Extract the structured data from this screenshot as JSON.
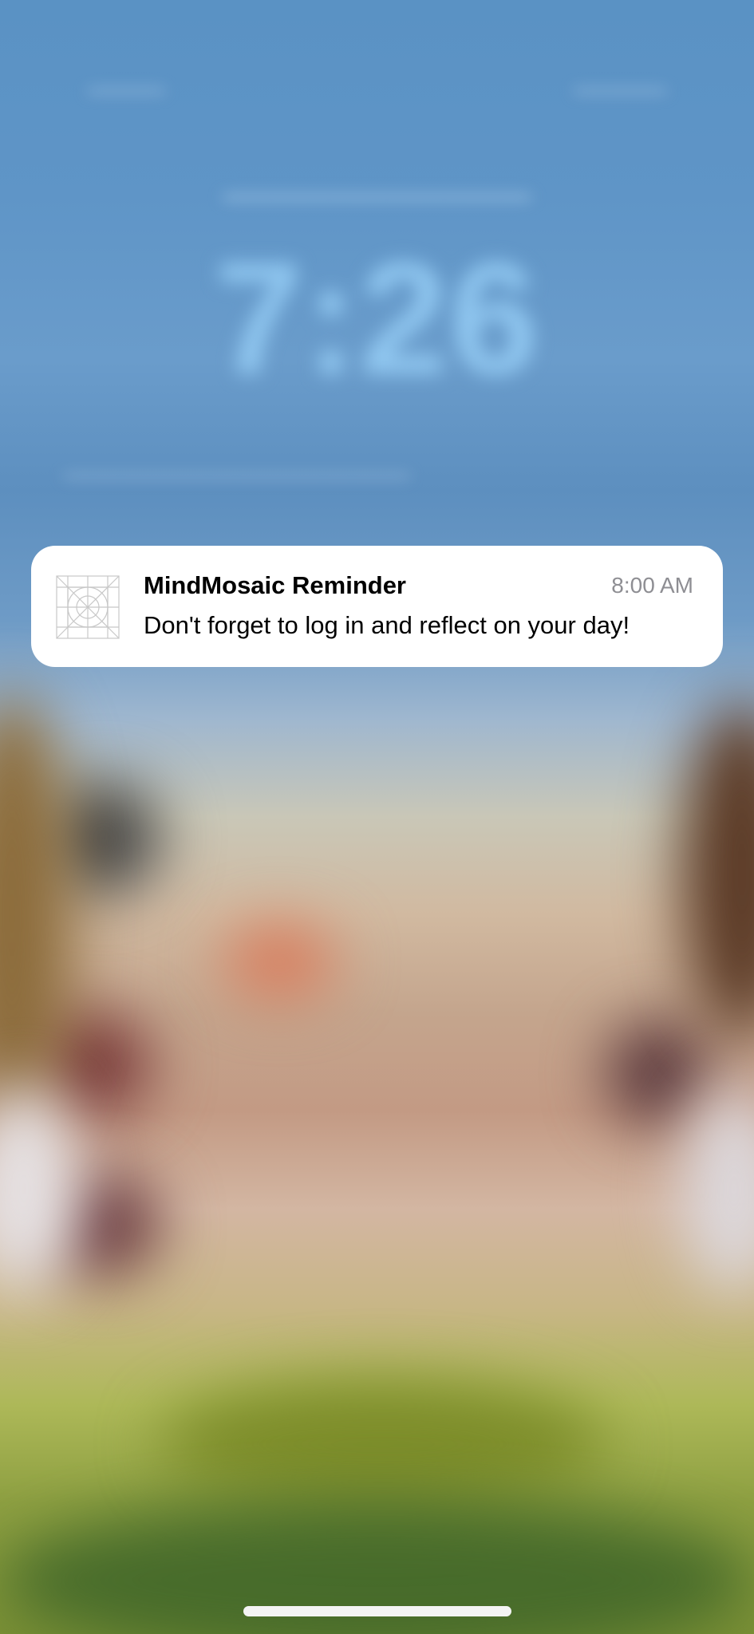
{
  "lock_screen": {
    "time": "7:26"
  },
  "notification": {
    "app_icon": "app-icon-placeholder",
    "title": "MindMosaic Reminder",
    "time": "8:00 AM",
    "body": "Don't forget to log in and reflect on your day!"
  },
  "colors": {
    "notification_bg": "#ffffff",
    "time_text": "#8e8e93",
    "home_indicator": "#f4f4f4"
  }
}
